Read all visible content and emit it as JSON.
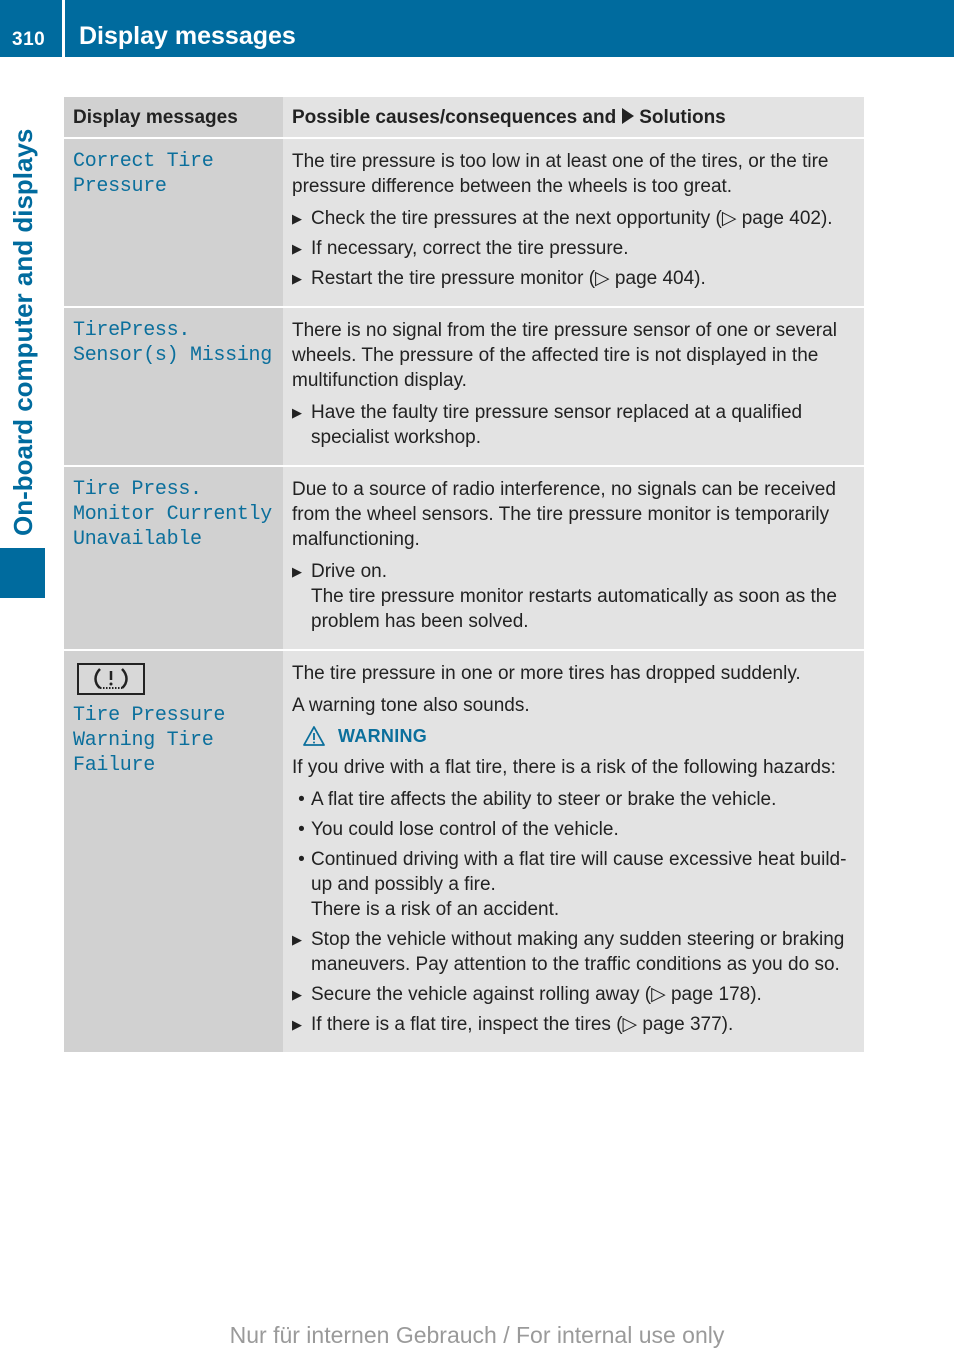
{
  "header": {
    "page_number": "310",
    "title": "Display messages"
  },
  "side_tab": {
    "label": "On-board computer and displays"
  },
  "table": {
    "col1_header": "Display messages",
    "col2_header_prefix": "Possible causes/consequences and",
    "col2_header_suffix": "Solutions",
    "rows": [
      {
        "message": "Correct Tire\nPressure",
        "content": {
          "p1": "The tire pressure is too low in at least one of the tires, or the tire pressure difference between the wheels is too great.",
          "steps": [
            "Check the tire pressures at the next opportunity (▷ page 402).",
            "If necessary, correct the tire pressure.",
            "Restart the tire pressure monitor (▷ page 404)."
          ]
        }
      },
      {
        "message": "TirePress.\nSensor(s) Missing",
        "content": {
          "p1": "There is no signal from the tire pressure sensor of one or several wheels. The pressure of the affected tire is not displayed in the multifunction display.",
          "steps": [
            "Have the faulty tire pressure sensor replaced at a qualified specialist workshop."
          ]
        }
      },
      {
        "message": "Tire Press.\nMonitor Currently\nUnavailable",
        "content": {
          "p1": "Due to a source of radio interference, no signals can be received from the wheel sensors. The tire pressure monitor is temporarily malfunctioning.",
          "step1": "Drive on.",
          "step1_detail": "The tire pressure monitor restarts automatically as soon as the problem has been solved."
        }
      },
      {
        "icon": "tire-pressure-warning-icon",
        "message": "Tire Pressure\nWarning Tire\nFailure",
        "content": {
          "p1": "The tire pressure in one or more tires has dropped suddenly.",
          "p2": "A warning tone also sounds.",
          "warning_label": "WARNING",
          "warning_intro": "If you drive with a flat tire, there is a risk of the following hazards:",
          "hazards": [
            "A flat tire affects the ability to steer or brake the vehicle.",
            "You could lose control of the vehicle.",
            "Continued driving with a flat tire will cause excessive heat build-up and possibly a fire."
          ],
          "risk": "There is a risk of an accident.",
          "steps": [
            "Stop the vehicle without making any sudden steering or braking maneuvers. Pay attention to the traffic conditions as you do so.",
            "Secure the vehicle against rolling away (▷ page 178).",
            "If there is a flat tire, inspect the tires (▷ page 377)."
          ]
        }
      }
    ]
  },
  "footer": {
    "watermark": "Nur für internen Gebrauch / For internal use only"
  },
  "colors": {
    "brand_blue": "#006b9e",
    "message_text": "#0b6f9c",
    "col1_bg": "#d1d1d1",
    "col2_bg": "#e3e3e3"
  }
}
